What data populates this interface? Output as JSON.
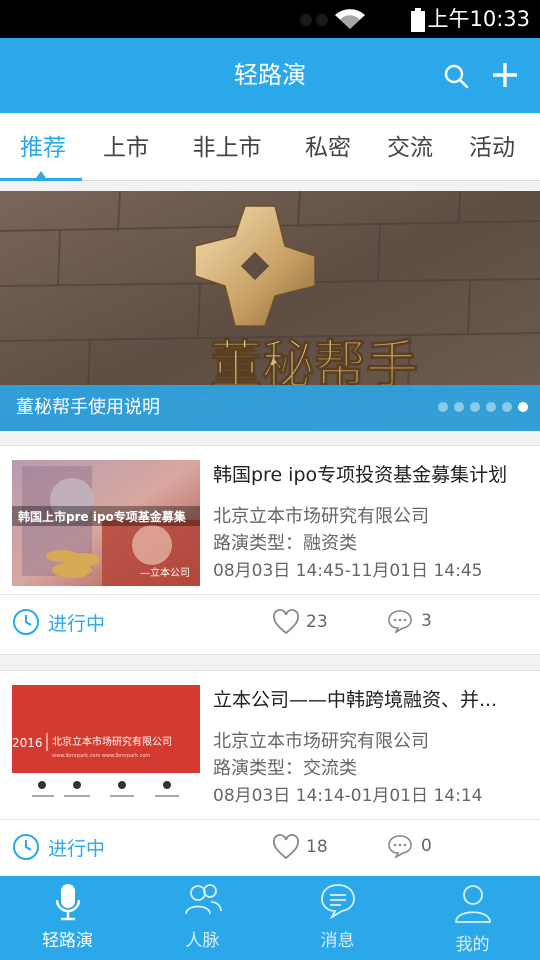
{
  "status_bar": {
    "time": "上午10:33"
  },
  "header": {
    "title": "轻路演"
  },
  "tabs": [
    {
      "label": "推荐",
      "active": true
    },
    {
      "label": "上市"
    },
    {
      "label": "非上市"
    },
    {
      "label": "私密"
    },
    {
      "label": "交流"
    },
    {
      "label": "活动"
    }
  ],
  "banner": {
    "caption": "董秘帮手使用说明",
    "logo_text": "董秘帮手",
    "slide_count": 6,
    "active_slide": 6
  },
  "cards": [
    {
      "title": "韩国pre ipo专项投资基金募集计划",
      "company": "北京立本市场研究有限公司",
      "type": "路演类型：融资类",
      "time": "08月03日 14:45-11月01日 14:45",
      "status": "进行中",
      "likes": "23",
      "comments": "3",
      "thumb_text": "韩国上市pre ipo专项基金募集",
      "thumb_sub": "—立本公司"
    },
    {
      "title": "立本公司——中韩跨境融资、并...",
      "company": "北京立本市场研究有限公司",
      "type": "路演类型：交流类",
      "time": "08月03日 14:14-01月01日 14:14",
      "status": "进行中",
      "likes": "18",
      "comments": "0",
      "thumb_year": "2016",
      "thumb_text": "北京立本市场研究有限公司",
      "thumb_url": "www.lbmrpark.com     www.lbmrpark.com"
    }
  ],
  "bottom_nav": [
    {
      "label": "轻路演",
      "icon": "microphone-icon",
      "active": true
    },
    {
      "label": "人脉",
      "icon": "people-icon"
    },
    {
      "label": "消息",
      "icon": "message-icon"
    },
    {
      "label": "我的",
      "icon": "user-icon"
    }
  ],
  "colors": {
    "primary": "#2ba8ea",
    "status_bar": "#000000",
    "banner_brown": "#6b5a4e",
    "thumb_red": "#d43b30"
  }
}
